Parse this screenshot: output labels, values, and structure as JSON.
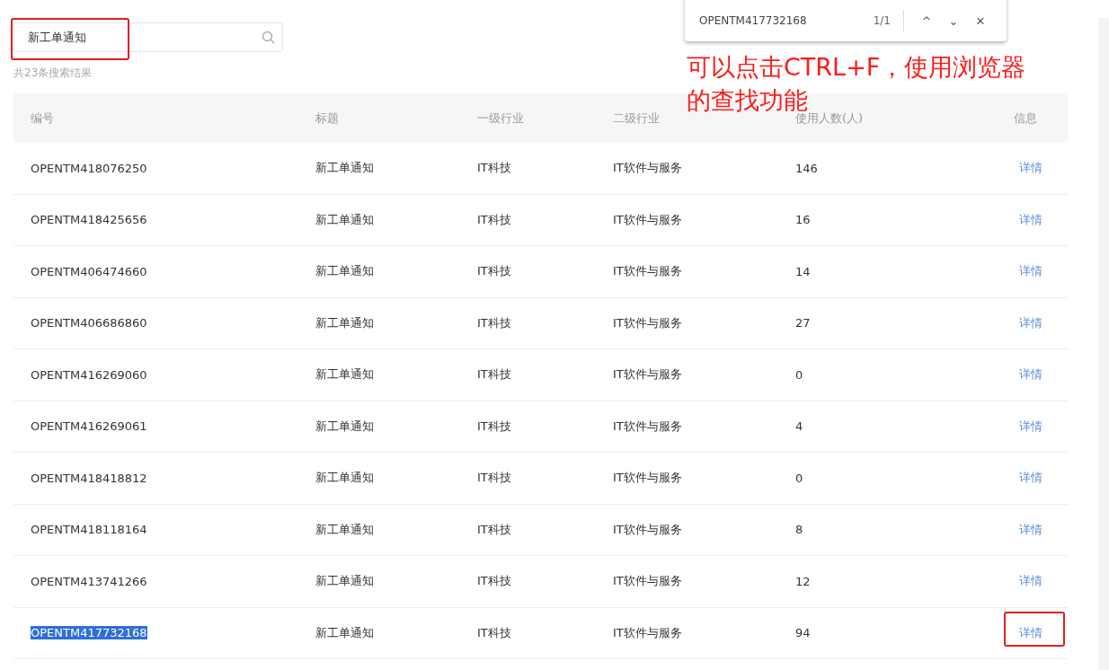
{
  "search": {
    "value": "新工单通知",
    "annotated": true
  },
  "result_count": "共23条搜索结果",
  "find_bar": {
    "query": "OPENTM417732168",
    "count": "1/1",
    "prev": "^",
    "next": "⌄",
    "close": "✕"
  },
  "annotation": "可以点击CTRL+F，使用浏览器的查找功能",
  "table": {
    "columns": [
      "编号",
      "标题",
      "一级行业",
      "二级行业",
      "使用人数(人)",
      "信息"
    ],
    "rows": [
      {
        "id": "OPENTM418076250",
        "title": "新工单通知",
        "industry_1": "IT科技",
        "industry_2": "IT软件与服务",
        "users": "146",
        "link": "详情",
        "highlighted": false,
        "annotated": false
      },
      {
        "id": "OPENTM418425656",
        "title": "新工单通知",
        "industry_1": "IT科技",
        "industry_2": "IT软件与服务",
        "users": "16",
        "link": "详情",
        "highlighted": false,
        "annotated": false
      },
      {
        "id": "OPENTM406474660",
        "title": "新工单通知",
        "industry_1": "IT科技",
        "industry_2": "IT软件与服务",
        "users": "14",
        "link": "详情",
        "highlighted": false,
        "annotated": false
      },
      {
        "id": "OPENTM406686860",
        "title": "新工单通知",
        "industry_1": "IT科技",
        "industry_2": "IT软件与服务",
        "users": "27",
        "link": "详情",
        "highlighted": false,
        "annotated": false
      },
      {
        "id": "OPENTM416269060",
        "title": "新工单通知",
        "industry_1": "IT科技",
        "industry_2": "IT软件与服务",
        "users": "0",
        "link": "详情",
        "highlighted": false,
        "annotated": false
      },
      {
        "id": "OPENTM416269061",
        "title": "新工单通知",
        "industry_1": "IT科技",
        "industry_2": "IT软件与服务",
        "users": "4",
        "link": "详情",
        "highlighted": false,
        "annotated": false
      },
      {
        "id": "OPENTM418418812",
        "title": "新工单通知",
        "industry_1": "IT科技",
        "industry_2": "IT软件与服务",
        "users": "0",
        "link": "详情",
        "highlighted": false,
        "annotated": false
      },
      {
        "id": "OPENTM418118164",
        "title": "新工单通知",
        "industry_1": "IT科技",
        "industry_2": "IT软件与服务",
        "users": "8",
        "link": "详情",
        "highlighted": false,
        "annotated": false
      },
      {
        "id": "OPENTM413741266",
        "title": "新工单通知",
        "industry_1": "IT科技",
        "industry_2": "IT软件与服务",
        "users": "12",
        "link": "详情",
        "highlighted": false,
        "annotated": false
      },
      {
        "id": "OPENTM417732168",
        "title": "新工单通知",
        "industry_1": "IT科技",
        "industry_2": "IT软件与服务",
        "users": "94",
        "link": "详情",
        "highlighted": true,
        "annotated": true
      }
    ]
  }
}
